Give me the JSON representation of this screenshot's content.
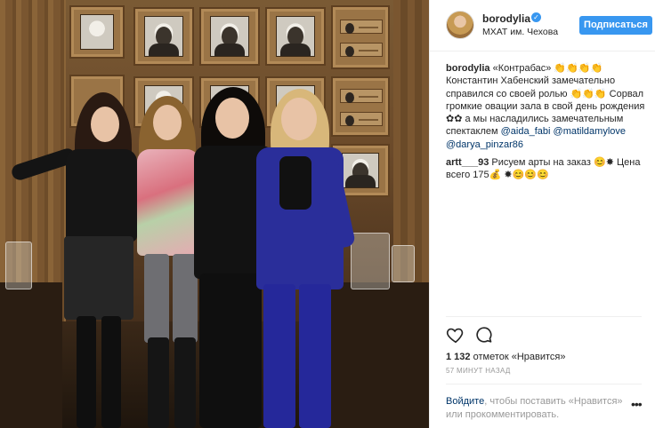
{
  "post": {
    "photo_alt": "Group photo of four women",
    "likes_count": "1 132",
    "likes_suffix": "отметок «Нравится»",
    "time": "57 МИНУТ НАЗАД"
  },
  "header": {
    "username": "borodylia",
    "verified_icon": "verified-badge-icon",
    "location": "МХАТ им. Чехова",
    "follow_label": "Подписаться"
  },
  "comments": [
    {
      "user": "borodylia",
      "text": " «Контрабас» 👏👏👏👏 Константин Хабенский замечательно справился со своей ролью 👏👏👏 Сорвал громкие овации зала в свой день рождения ✿✿ а мы насладились замечательным спектаклем ",
      "mentions": [
        "@aida_fabi",
        "@matildamylove",
        "@darya_pinzar86"
      ]
    },
    {
      "user": "artt___93",
      "text": " Рисуем арты на заказ 😊✸ Цена всего 175💰 ✸😊😊😊"
    }
  ],
  "actions": {
    "like_icon": "heart-icon",
    "comment_icon": "comment-bubble-icon"
  },
  "footer": {
    "login_link": "Войдите",
    "login_text": ", чтобы поставить «Нравится» или прокомментировать.",
    "more_label": "•••"
  },
  "colors": {
    "accent": "#3897f0",
    "link": "#003569",
    "muted": "#999999"
  }
}
